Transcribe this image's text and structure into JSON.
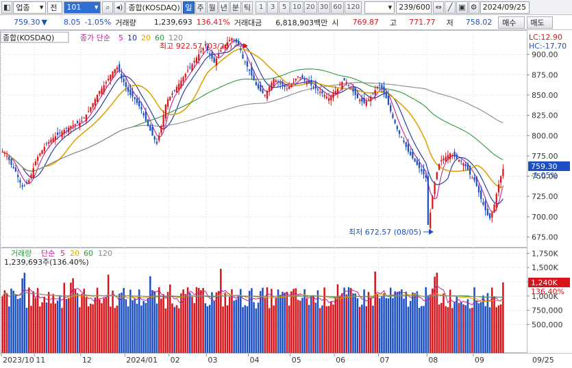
{
  "toolbar": {
    "market_select": "업종",
    "period_label": "전",
    "code_value": "101",
    "index_name": "종합(KOSDAQ)",
    "period_tabs": [
      "일",
      "주",
      "월",
      "년",
      "분",
      "틱"
    ],
    "interval_buttons": [
      "1",
      "3",
      "5",
      "10",
      "20",
      "30",
      "60",
      "120"
    ],
    "count_value": "239/600",
    "date_value": "2024/09/25"
  },
  "quote": {
    "price": "759.30",
    "change": "8.05",
    "change_pct": "-1.05%",
    "volume_label": "거래량",
    "volume_value": "1,239,693",
    "volume_ratio": "136.41%",
    "amount_label": "거래대금",
    "amount_value": "6,818,903백만",
    "open_label": "시",
    "open_value": "769.87",
    "high_label": "고",
    "high_value": "771.77",
    "low_label": "저",
    "low_value": "758.02",
    "buy_label": "매수",
    "sell_label": "매도"
  },
  "price_panel": {
    "legend_title": "종합(KOSDAQ)",
    "legend_ma": "종가 단순",
    "legend_periods": [
      "5",
      "10",
      "20",
      "60",
      "120"
    ],
    "lc_label": "LC:12.90",
    "hc_label": "HC:-17.70",
    "high_annotation": "최고 922.57 (03/26)",
    "low_annotation": "최저 672.57 (08/05)",
    "current_price_tag": "759.30",
    "current_change_tag": "-1.05%"
  },
  "volume_panel": {
    "legend_title": "거래량",
    "legend_ma": "단순",
    "legend_periods": [
      "5",
      "20",
      "60",
      "120"
    ],
    "last_volume": "1,239,693주(136.40%)",
    "current_tag": "1,240K",
    "current_pct": "136.40%"
  },
  "colors": {
    "up": "#d8141a",
    "down": "#1c4fc4",
    "ma5": "#c0209a",
    "ma10": "#1a2aa0",
    "ma20": "#e0a000",
    "ma60": "#2a9a3a",
    "ma120": "#888888"
  },
  "chart_data": {
    "type": "candlestick",
    "y_axis_price": {
      "ticks": [
        675,
        700,
        725,
        750,
        775,
        800,
        825,
        850,
        875,
        900
      ],
      "ylim": [
        662,
        930
      ]
    },
    "y_axis_volume": {
      "ticks": [
        "500,000",
        "750,000",
        "1,000K",
        "1,250K",
        "1,500K",
        "1,750K"
      ],
      "ylim": [
        0,
        1850000
      ]
    },
    "x_labels": [
      "2023/10",
      "11",
      "12",
      "2024/01",
      "02",
      "03",
      "04",
      "05",
      "06",
      "07",
      "08",
      "09"
    ],
    "x_right_label": "09/25",
    "close_series": [
      {
        "month": "2023/10",
        "values": [
          780,
          778,
          775,
          770,
          764,
          760,
          756,
          749,
          742,
          737,
          738,
          741,
          745,
          752,
          760
        ]
      },
      {
        "month": "11",
        "values": [
          768,
          774,
          778,
          782,
          786,
          790,
          792,
          795,
          797,
          799,
          801,
          803,
          805,
          807,
          809,
          810,
          812,
          813,
          814,
          815,
          816
        ]
      },
      {
        "month": "12",
        "values": [
          818,
          822,
          826,
          830,
          835,
          840,
          845,
          850,
          855,
          858,
          862,
          866,
          870,
          875,
          879,
          882,
          884,
          880,
          870,
          866
        ]
      },
      {
        "month": "2024/01",
        "values": [
          860,
          854,
          850,
          848,
          845,
          840,
          836,
          832,
          825,
          818,
          812,
          806,
          800,
          795,
          790,
          800,
          812,
          825,
          838,
          845
        ]
      },
      {
        "month": "02",
        "values": [
          848,
          852,
          856,
          860,
          864,
          868,
          872,
          876,
          880,
          884,
          888,
          892,
          896,
          900,
          904,
          908,
          912
        ]
      },
      {
        "month": "03",
        "values": [
          905,
          900,
          895,
          890,
          895,
          900,
          905,
          910,
          912,
          915,
          918,
          920,
          918,
          915,
          912,
          905,
          895,
          890,
          885
        ]
      },
      {
        "month": "04",
        "values": [
          880,
          874,
          868,
          862,
          858,
          855,
          852,
          850,
          855,
          860,
          865,
          870,
          868,
          866,
          864,
          862,
          860,
          858,
          860
        ]
      },
      {
        "month": "05",
        "values": [
          862,
          866,
          870,
          873,
          872,
          870,
          868,
          866,
          864,
          862,
          860,
          858,
          856,
          854,
          852,
          850,
          848,
          846,
          849,
          852
        ]
      },
      {
        "month": "06",
        "values": [
          855,
          858,
          862,
          866,
          868,
          866,
          862,
          858,
          854,
          850,
          846,
          844,
          842,
          840,
          842,
          845,
          848,
          852,
          856,
          860
        ]
      },
      {
        "month": "07",
        "values": [
          862,
          858,
          852,
          846,
          838,
          830,
          822,
          815,
          808,
          802,
          798,
          792,
          786,
          780,
          776,
          772,
          768,
          764,
          760,
          756,
          752,
          748
        ]
      },
      {
        "month": "08",
        "values": [
          690,
          705,
          725,
          742,
          755,
          765,
          770,
          772,
          774,
          776,
          778,
          776,
          774,
          772,
          770,
          768,
          766,
          762,
          758,
          752,
          748
        ]
      },
      {
        "month": "09",
        "values": [
          745,
          738,
          730,
          722,
          715,
          708,
          702,
          698,
          705,
          715,
          728,
          740,
          750,
          759
        ]
      }
    ]
  }
}
